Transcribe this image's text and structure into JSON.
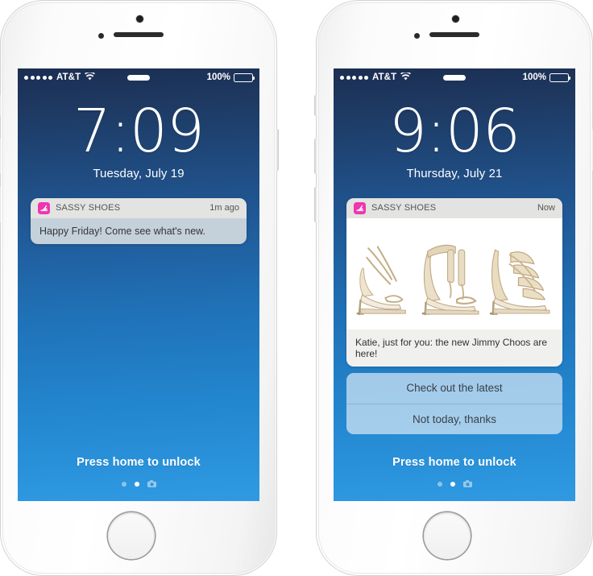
{
  "phones": [
    {
      "id": "phone-left",
      "status_bar": {
        "signal_dots": 5,
        "carrier": "AT&T",
        "wifi_icon": "wifi-icon",
        "battery_percent": "100%",
        "battery_level": 100
      },
      "lock_screen": {
        "time": "7:09",
        "date": "Tuesday, July 19",
        "unlock_text": "Press home to unlock",
        "page_dots": {
          "count": 2,
          "active_index": 1,
          "camera_icon": "camera-icon"
        }
      },
      "notification": {
        "type": "text",
        "app_icon": "high-heel-shoe-icon",
        "app_icon_color": "#ee36b0",
        "app_name": "SASSY SHOES",
        "timestamp": "1m ago",
        "message": "Happy Friday! Come see what's new.",
        "actions": []
      }
    },
    {
      "id": "phone-right",
      "status_bar": {
        "signal_dots": 5,
        "carrier": "AT&T",
        "wifi_icon": "wifi-icon",
        "battery_percent": "100%",
        "battery_level": 100
      },
      "lock_screen": {
        "time": "9:06",
        "date": "Thursday, July 21",
        "unlock_text": "Press home to unlock",
        "page_dots": {
          "count": 2,
          "active_index": 1,
          "camera_icon": "camera-icon"
        }
      },
      "notification": {
        "type": "rich",
        "app_icon": "high-heel-shoe-icon",
        "app_icon_color": "#ee36b0",
        "app_name": "SASSY SHOES",
        "timestamp": "Now",
        "message": "Katie, just for you: the new Jimmy Choos are here!",
        "images": [
          {
            "alt": "gold strappy stiletto sandal"
          },
          {
            "alt": "nude tassel ankle-strap stiletto sandal"
          },
          {
            "alt": "gold cutout caged stiletto sandal"
          }
        ],
        "actions": [
          {
            "label": "Check out the latest"
          },
          {
            "label": "Not today, thanks"
          }
        ]
      }
    }
  ],
  "colors": {
    "brand_pink": "#ee36b0",
    "screen_top": "#1c2e52",
    "screen_bottom": "#2f9ae2",
    "notif_header_bg": "#e3e3e1",
    "notif_body_bg": "#c4d0da",
    "action_bg": "#d6e8f5"
  }
}
